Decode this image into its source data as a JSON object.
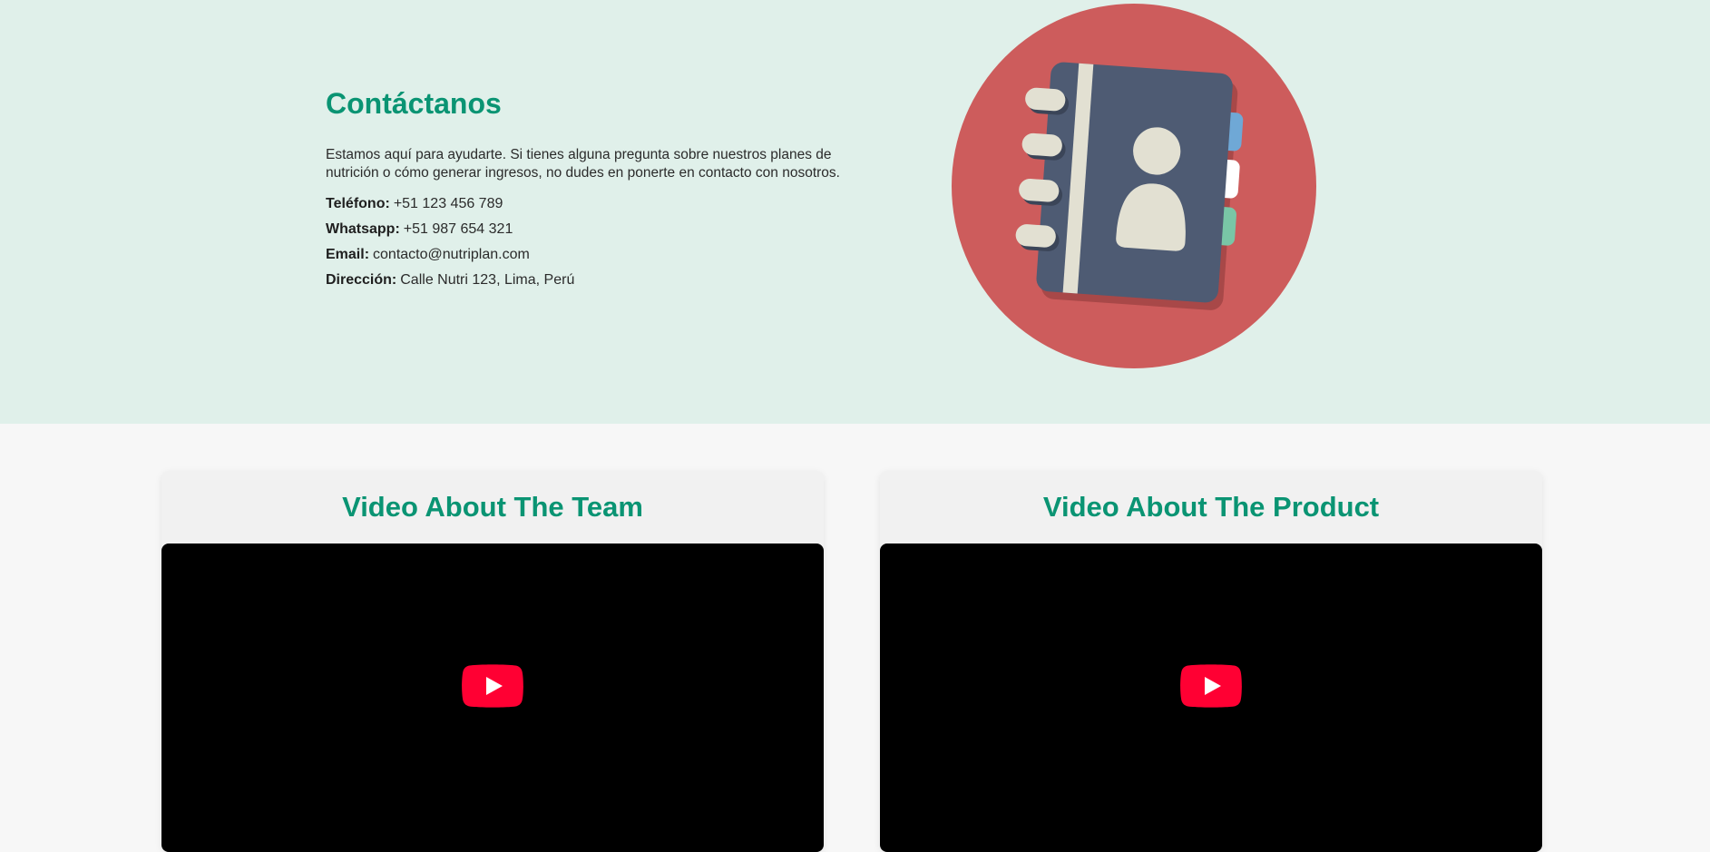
{
  "contact": {
    "title": "Contáctanos",
    "description": "Estamos aquí para ayudarte. Si tienes alguna pregunta sobre nuestros planes de nutrición o cómo generar ingresos, no dudes en ponerte en contacto con nosotros.",
    "phone": {
      "label": "Teléfono:",
      "value": "+51 123 456 789"
    },
    "whatsapp": {
      "label": "Whatsapp:",
      "value": "+51 987 654 321"
    },
    "email": {
      "label": "Email:",
      "value": "contacto@nutriplan.com"
    },
    "address": {
      "label": "Dirección:",
      "value": "Calle Nutri 123, Lima, Perú"
    },
    "illustration_icon": "address-book-icon"
  },
  "videos": [
    {
      "title": "Video About The Team",
      "play_icon": "youtube-play-icon"
    },
    {
      "title": "Video About The Product",
      "play_icon": "youtube-play-icon"
    }
  ],
  "colors": {
    "accent": "#0a9473",
    "contact_bg": "#e0f0ea",
    "page_bg": "#f7f7f7",
    "youtube_red": "#ff0033",
    "illustration_circle": "#cd5c5c",
    "book_cover": "#4e5b73"
  }
}
